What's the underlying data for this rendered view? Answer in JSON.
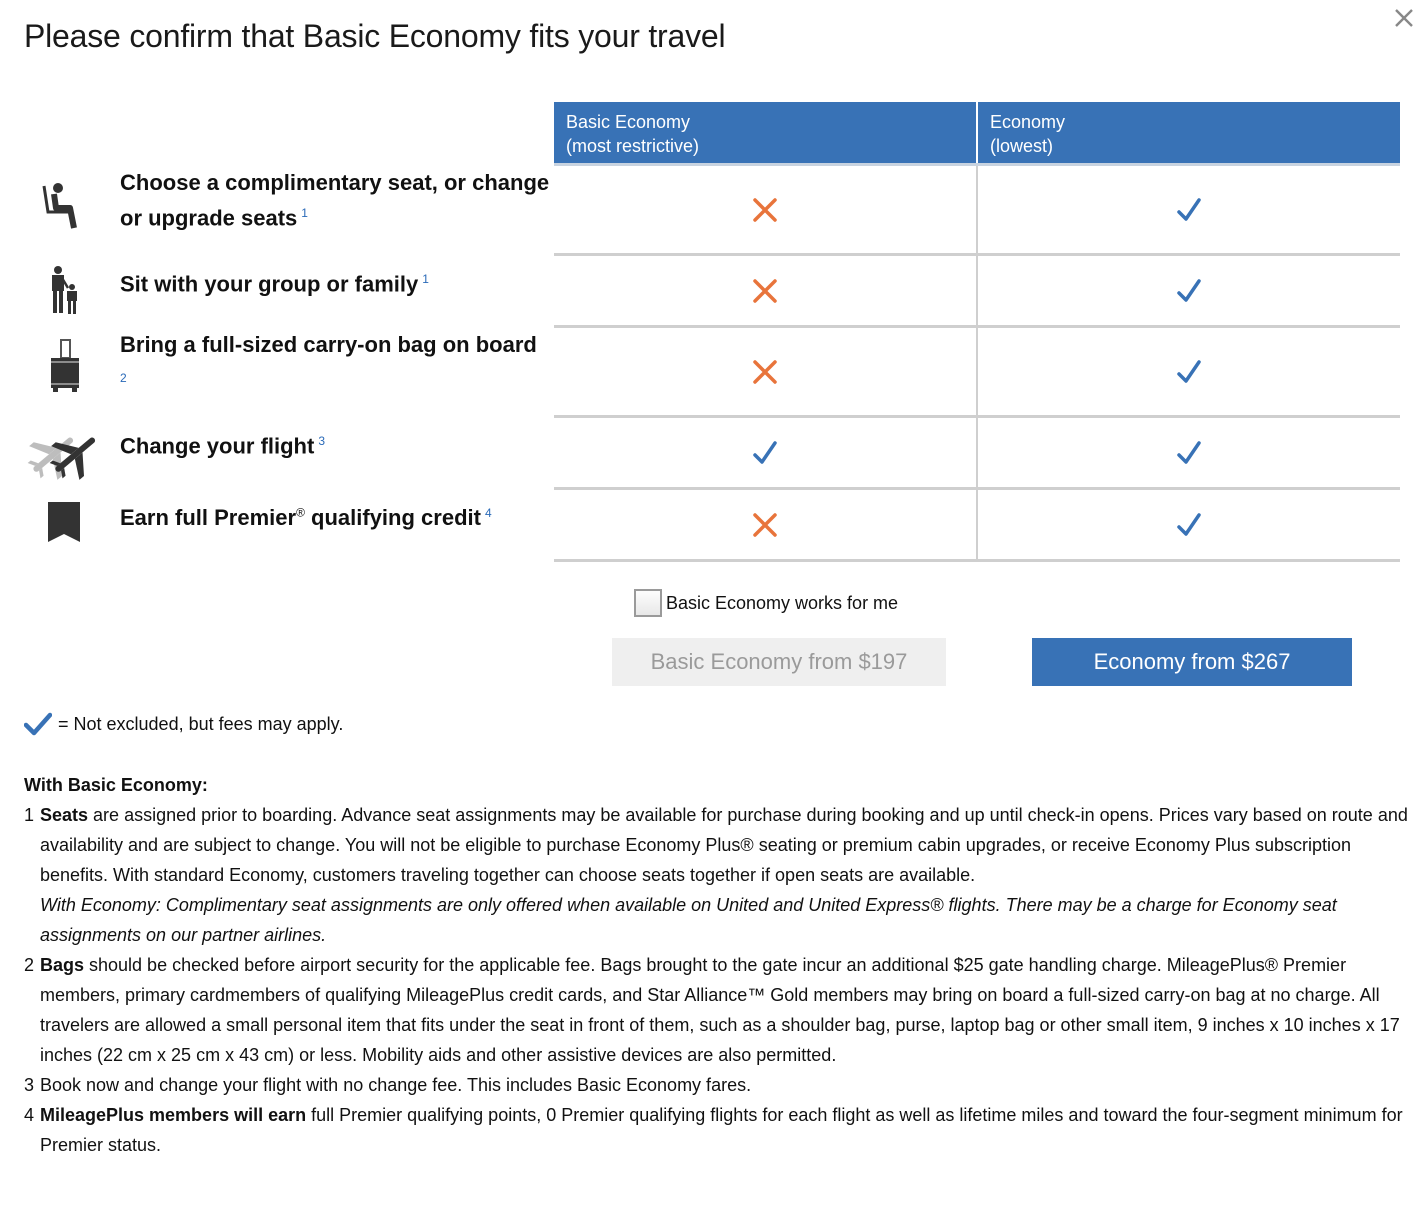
{
  "dialog": {
    "title": "Please confirm that Basic Economy fits your travel",
    "close_icon": "close-icon"
  },
  "table": {
    "columns": [
      {
        "line1": "Basic Economy",
        "line2": "(most restrictive)"
      },
      {
        "line1": "Economy",
        "line2": "(lowest)"
      }
    ],
    "header_color": "#3872b6",
    "rows": [
      {
        "icon": "seat-icon",
        "label": "Choose a complimentary seat, or change or upgrade seats",
        "footnote": "1",
        "basic": "cross",
        "economy": "check"
      },
      {
        "icon": "family-icon",
        "label": "Sit with your group or family",
        "footnote": "1",
        "basic": "cross",
        "economy": "check"
      },
      {
        "icon": "carry-on-bag-icon",
        "label": "Bring a full-sized carry-on bag on board",
        "footnote": "2",
        "basic": "cross",
        "economy": "check"
      },
      {
        "icon": "change-flight-icon",
        "label": "Change your flight",
        "footnote": "3",
        "basic": "check",
        "economy": "check"
      },
      {
        "icon": "premier-credit-icon",
        "label_pre": "Earn full Premier",
        "label_reg": "®",
        "label_post": " qualifying credit",
        "footnote": "4",
        "basic": "cross",
        "economy": "check"
      }
    ],
    "cross_color": "#e8743b",
    "check_color": "#3872b6"
  },
  "confirm": {
    "checkbox_label": "Basic Economy works for me",
    "checked": false
  },
  "buttons": {
    "basic": "Basic Economy from $197",
    "economy": "Economy from $267"
  },
  "legend": {
    "text": "= Not excluded, but fees may apply."
  },
  "notes": {
    "heading": "With Basic Economy:",
    "items": [
      {
        "num": "1",
        "bold": "Seats",
        "text": " are assigned prior to boarding. Advance seat assignments may be available for purchase during booking and up until check-in opens. Prices vary based on route and availability and are subject to change. You will not be eligible to purchase Economy Plus® seating or premium cabin upgrades, or receive Economy Plus subscription benefits. With standard Economy, customers traveling together can choose seats together if open seats are available.",
        "italic": "With Economy: Complimentary seat assignments are only offered when available on United and United Express® flights. There may be a charge for Economy seat assignments on our partner airlines."
      },
      {
        "num": "2",
        "bold": "Bags",
        "text": " should be checked before airport security for the applicable fee. Bags brought to the gate incur an additional $25 gate handling charge. MileagePlus® Premier members, primary cardmembers of qualifying MileagePlus credit cards, and Star Alliance™ Gold members may bring on board a full-sized carry-on bag at no charge. All travelers are allowed a small personal item that fits under the seat in front of them, such as a shoulder bag, purse, laptop bag or other small item, 9 inches x 10 inches x 17 inches (22 cm x 25 cm x 43 cm) or less. Mobility aids and other assistive devices are also permitted."
      },
      {
        "num": "3",
        "bold": "",
        "text": "Book now and change your flight with no change fee. This includes Basic Economy fares."
      },
      {
        "num": "4",
        "bold": "MileagePlus members will earn",
        "text": " full Premier qualifying points, 0 Premier qualifying flights for each flight as well as lifetime miles and toward the four-segment minimum for Premier status."
      }
    ]
  }
}
